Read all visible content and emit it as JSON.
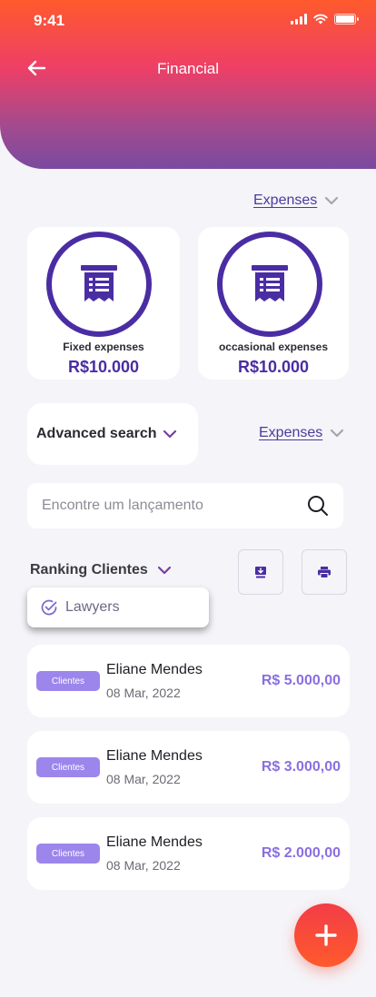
{
  "status_bar": {
    "time": "9:41"
  },
  "header": {
    "title": "Financial"
  },
  "filters": {
    "top_filter": "Expenses",
    "second_filter": "Expenses",
    "advanced_search": "Advanced search",
    "ranking": "Ranking Clientes"
  },
  "cards": [
    {
      "label": "Fixed expenses",
      "amount": "R$10.000"
    },
    {
      "label": "occasional expenses",
      "amount": "R$10.000"
    }
  ],
  "search": {
    "placeholder": "Encontre um lançamento"
  },
  "dropdown": {
    "selected_option": "Lawyers"
  },
  "transactions": [
    {
      "tag": "Clientes",
      "name": "Eliane Mendes",
      "date": "08 Mar, 2022",
      "amount": "R$ 5.000,00"
    },
    {
      "tag": "Clientes",
      "name": "Eliane Mendes",
      "date": "08 Mar, 2022",
      "amount": "R$ 3.000,00"
    },
    {
      "tag": "Clientes",
      "name": "Eliane Mendes",
      "date": "08 Mar, 2022",
      "amount": "R$ 2.000,00"
    }
  ],
  "colors": {
    "primary": "#4a2da3",
    "accent": "#8a6fe0",
    "tag": "#9c86ec",
    "fab": "#ff4a3a"
  }
}
